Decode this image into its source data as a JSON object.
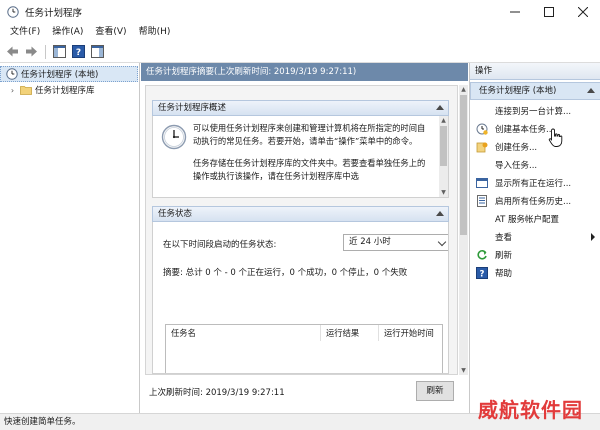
{
  "window": {
    "title": "任务计划程序",
    "controls": [
      "minimize-icon",
      "maximize-icon",
      "close-icon"
    ]
  },
  "menu": {
    "items": [
      "文件(F)",
      "操作(A)",
      "查看(V)",
      "帮助(H)"
    ]
  },
  "toolbar": {
    "buttons": [
      "back-arrow-icon",
      "forward-arrow-icon",
      "show-hide-tree-icon",
      "help-icon",
      "show-hide-action-pane-icon"
    ]
  },
  "tree": {
    "items": [
      {
        "label": "任务计划程序 (本地)",
        "selected": true,
        "icon": "scheduler-clock-icon"
      },
      {
        "label": "任务计划程序库",
        "selected": false,
        "icon": "folder-icon"
      }
    ]
  },
  "center": {
    "header": "任务计划程序摘要(上次刷新时间: 2019/3/19 9:27:11)",
    "overview": {
      "title": "任务计划程序概述",
      "para1": "可以使用任务计划程序来创建和管理计算机将在所指定的时间自动执行的常见任务。若要开始，请单击“操作”菜单中的命令。",
      "para2": "任务存储在任务计划程序库的文件夹中。若要查看单独任务上的操作或执行该操作，请在任务计划程序库中选"
    },
    "status": {
      "title": "任务状态",
      "filter_label": "在以下时间段启动的任务状态:",
      "filter_value": "近 24 小时",
      "summary": "摘要: 总计 0 个 - 0 个正在运行，0 个成功，0 个停止，0 个失败",
      "columns": [
        "任务名",
        "运行结果",
        "运行开始时间"
      ]
    },
    "footer": {
      "last_refresh": "上次刷新时间: 2019/3/19 9:27:11",
      "refresh_button": "刷新"
    }
  },
  "actions": {
    "title": "操作",
    "section": "任务计划程序 (本地)",
    "items": [
      {
        "label": "连接到另一台计算...",
        "icon": ""
      },
      {
        "label": "创建基本任务...",
        "icon": "basic-task-icon"
      },
      {
        "label": "创建任务...",
        "icon": "create-task-icon"
      },
      {
        "label": "导入任务...",
        "icon": ""
      },
      {
        "label": "显示所有正在运行...",
        "icon": "running-tasks-icon"
      },
      {
        "label": "启用所有任务历史...",
        "icon": "task-history-icon"
      },
      {
        "label": "AT 服务帐户配置",
        "icon": ""
      },
      {
        "label": "查看",
        "icon": ""
      },
      {
        "label": "刷新",
        "icon": "refresh-icon"
      },
      {
        "label": "帮助",
        "icon": "help-icon"
      }
    ]
  },
  "statusbar": {
    "text": "快速创建简单任务。"
  },
  "watermark": {
    "text": "威航软件园"
  },
  "colors": {
    "center_header_bg": "#6d89aa",
    "selection_bg": "#d9e7f5",
    "watermark": "#e23b3b"
  }
}
